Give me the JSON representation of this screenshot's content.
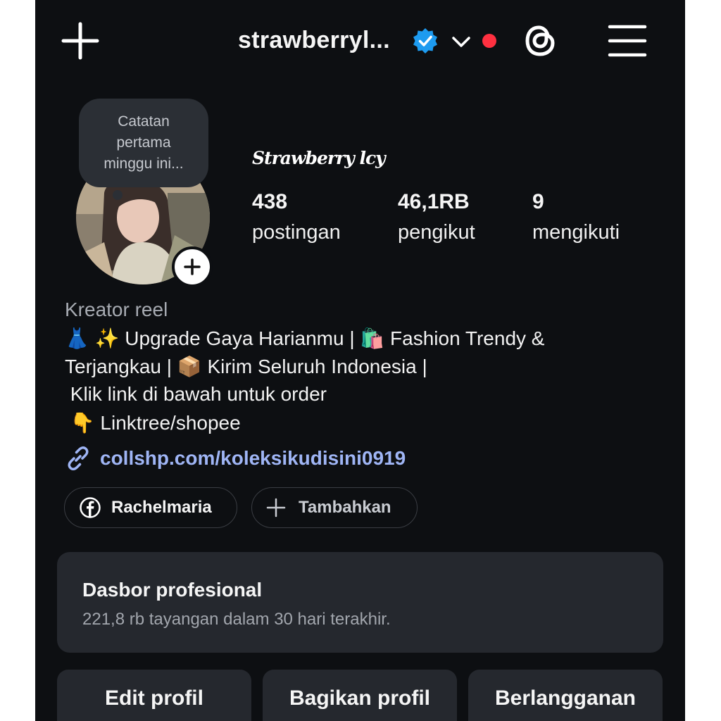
{
  "header": {
    "username": "strawberryl...",
    "icons": [
      "plus-icon",
      "verified-badge-icon",
      "chevron-down-icon",
      "notification-dot",
      "threads-icon",
      "hamburger-menu-icon"
    ],
    "verified_color": "#1d9bf0",
    "notification_dot_color": "#ff3040"
  },
  "note": {
    "text_line1": "Catatan",
    "text_line2": "pertama",
    "text_line3": "minggu ini..."
  },
  "profile": {
    "display_name": "Strawberry lcy",
    "stats": [
      {
        "value": "438",
        "label": "postingan"
      },
      {
        "value": "46,1RB",
        "label": "pengikut"
      },
      {
        "value": "9",
        "label": "mengikuti"
      }
    ]
  },
  "bio": {
    "category": "Kreator reel",
    "line1": "👗 ✨ Upgrade Gaya Harianmu | 🛍️ Fashion Trendy &",
    "line2": "Terjangkau | 📦 Kirim Seluruh Indonesia |",
    "line3": " Klik link di bawah untuk order",
    "line4": " 👇 Linktree/shopee",
    "link": "collshp.com/koleksikudisini0919",
    "link_color": "#9fb5f5"
  },
  "chips": {
    "facebook_label": "Rachelmaria",
    "add_label": "Tambahkan"
  },
  "dashboard": {
    "title": "Dasbor profesional",
    "subtitle": "221,8 rb tayangan dalam 30 hari terakhir."
  },
  "actions": {
    "edit": "Edit profil",
    "share": "Bagikan profil",
    "subscribe": "Berlangganan"
  }
}
